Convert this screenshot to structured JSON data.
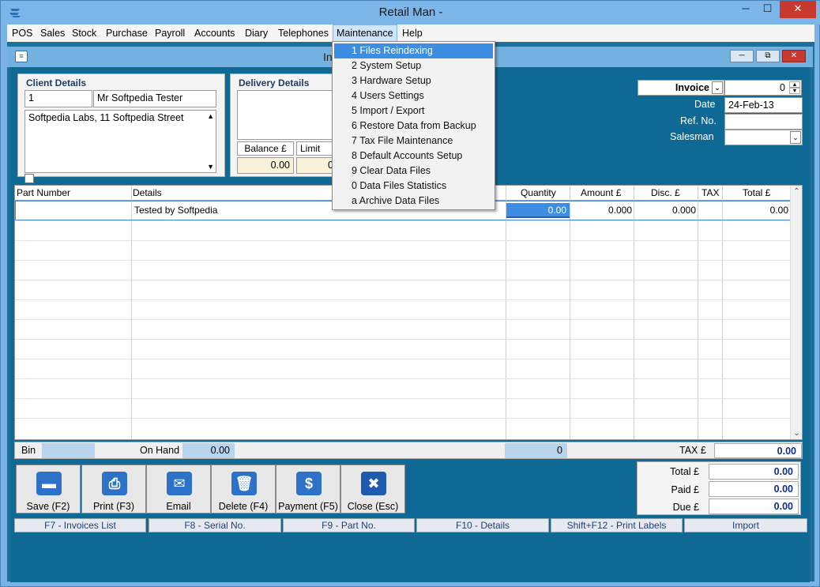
{
  "window": {
    "title": "Retail Man -"
  },
  "menu": [
    "POS",
    "Sales",
    "Stock",
    "Purchase",
    "Payroll",
    "Accounts",
    "Diary",
    "Telephones",
    "Maintenance",
    "Help"
  ],
  "child": {
    "title": "In"
  },
  "client": {
    "label": "Client Details",
    "code": "1",
    "name": "Mr Softpedia Tester",
    "address": "Softpedia Labs, 11 Softpedia Street"
  },
  "delivery": {
    "label": "Delivery Details",
    "balance_label": "Balance £",
    "limit_label": "Limit",
    "balance_value": "0.00",
    "limit_value": "0"
  },
  "invoice": {
    "type_label": "Invoice",
    "number": "0",
    "date_label": "Date",
    "date_value": "24-Feb-13",
    "ref_label": "Ref. No.",
    "ref_value": "",
    "salesman_label": "Salesman",
    "salesman_value": ""
  },
  "grid": {
    "headers": [
      "Part Number",
      "Details",
      "Quantity",
      "Amount £",
      "Disc. £",
      "TAX",
      "Total £"
    ],
    "row": {
      "part": "",
      "details": "Tested by Softpedia",
      "quantity": "0.00",
      "amount": "0.000",
      "disc": "0.000",
      "tax": "",
      "total": "0.00"
    }
  },
  "status": {
    "bin_label": "Bin",
    "bin_value": "",
    "onhand_label": "On Hand",
    "onhand_value": "0.00",
    "count_value": "0",
    "tax_label": "TAX £",
    "tax_value": "0.00"
  },
  "actions": [
    "Save (F2)",
    "Print (F3)",
    "Email",
    "Delete (F4)",
    "Payment (F5)",
    "Close (Esc)"
  ],
  "totals": {
    "total_label": "Total £",
    "total_value": "0.00",
    "paid_label": "Paid £",
    "paid_value": "0.00",
    "due_label": "Due £",
    "due_value": "0.00"
  },
  "fkeys": [
    "F7 - Invoices List",
    "F8 - Serial No.",
    "F9 - Part No.",
    "F10 - Details",
    "Shift+F12 - Print Labels",
    "Import"
  ],
  "maintenance_menu": [
    "1 Files Reindexing",
    "2 System Setup",
    "3 Hardware Setup",
    "4 Users Settings",
    "5 Import / Export",
    "6 Restore Data from Backup",
    "7 Tax File Maintenance",
    "8 Default Accounts Setup",
    "9 Clear Data Files",
    "0 Data Files Statistics",
    "a Archive Data Files"
  ],
  "colors": {
    "mdi_background": "#0e6a95",
    "menu_highlight": "#3d8ee2",
    "value_text": "#0b2f8a"
  }
}
